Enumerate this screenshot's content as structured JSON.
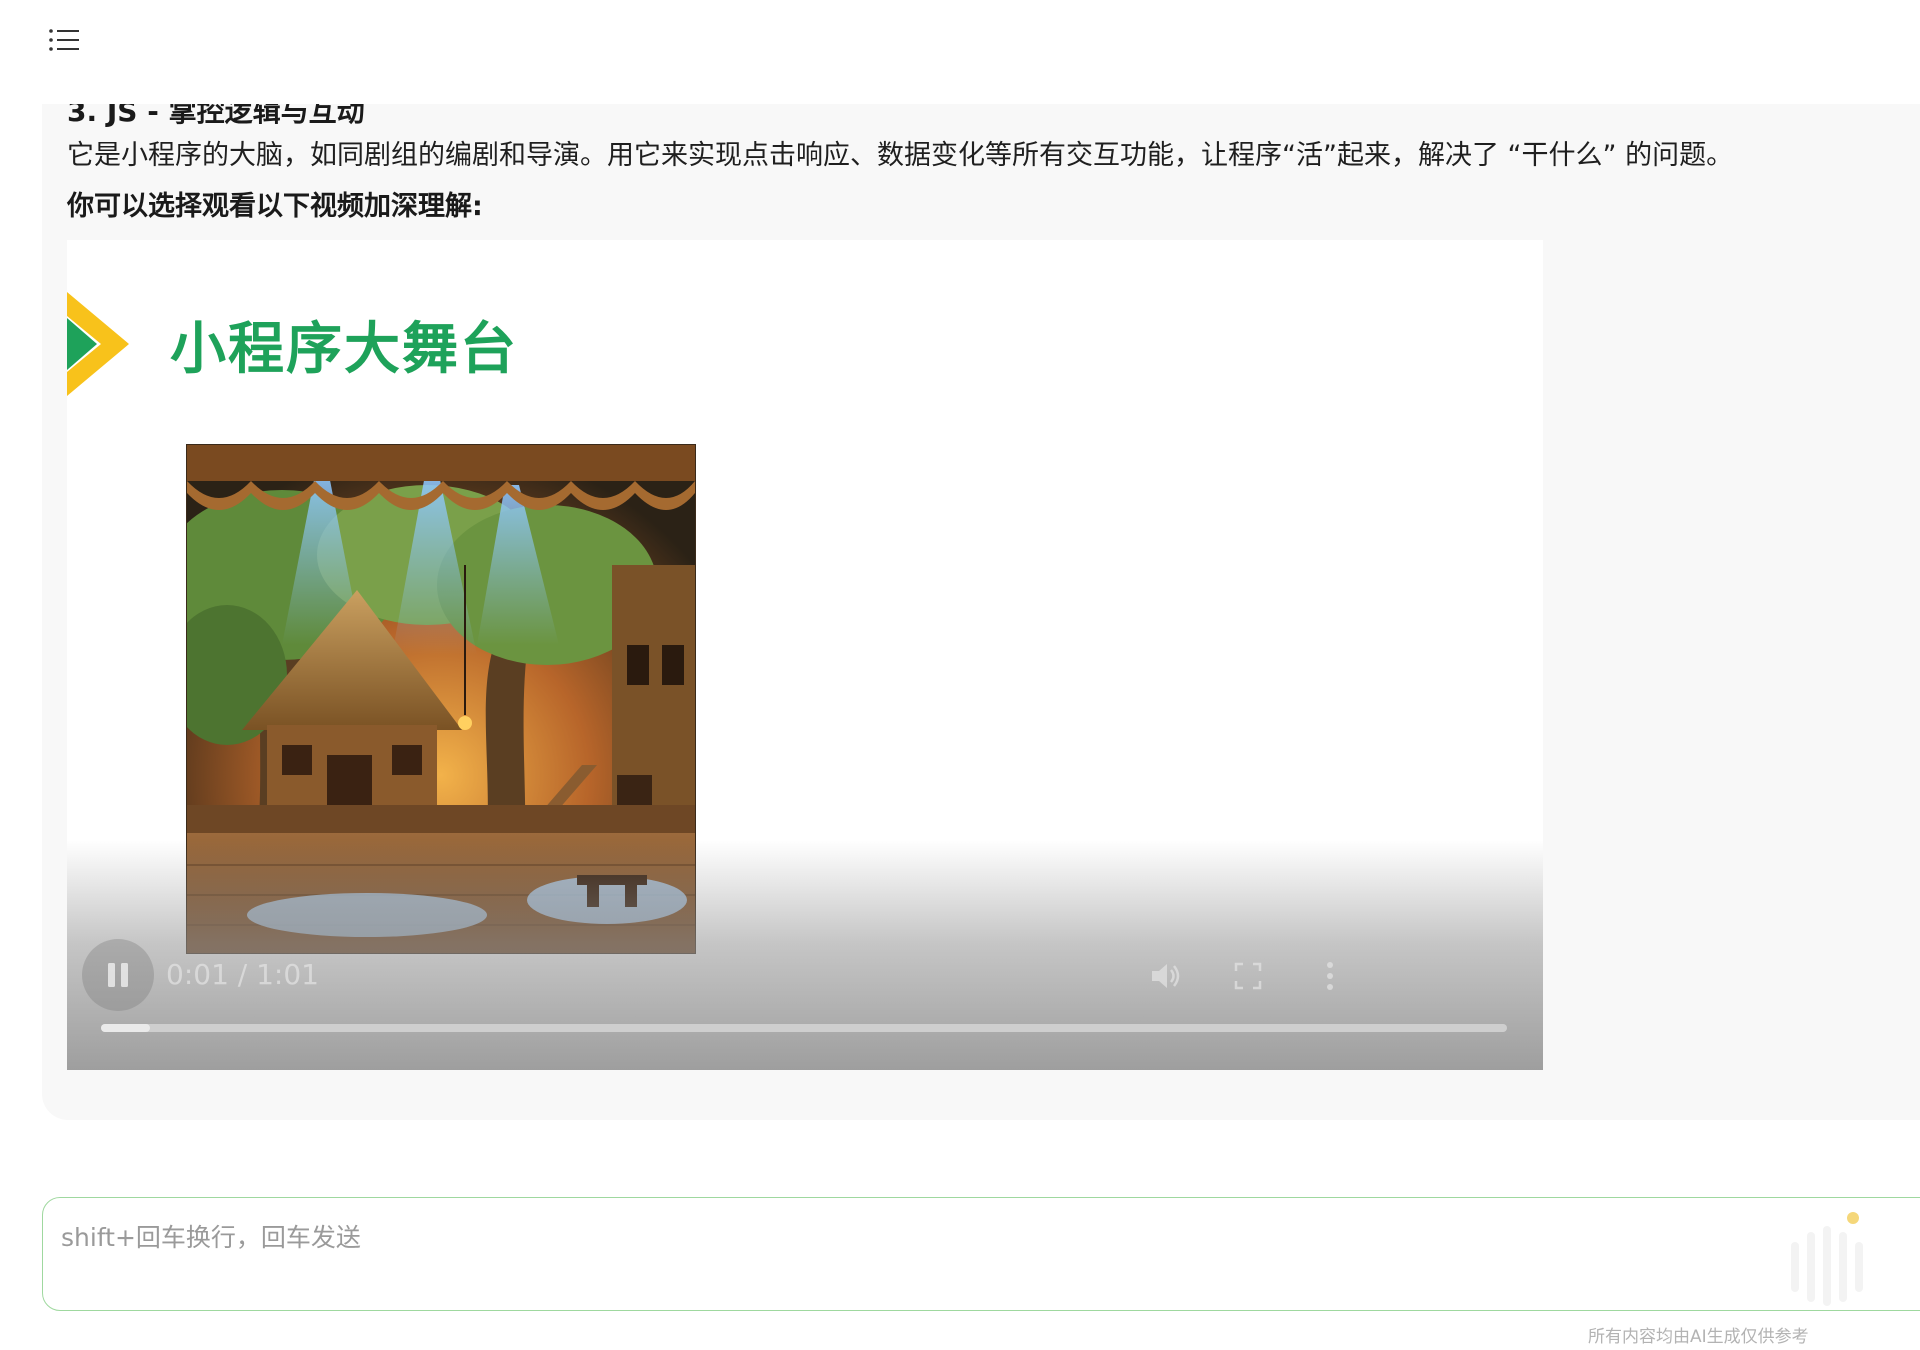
{
  "icons": {
    "menu": "list-icon",
    "slide_arrow": "play-arrow-icon",
    "play_pause": "pause-icon",
    "volume": "volume-icon",
    "fullscreen": "fullscreen-icon",
    "more": "more-vertical-icon",
    "voice": "voice-waveform-icon"
  },
  "message": {
    "section_heading": "3. JS - 掌控逻辑与互动",
    "paragraph": "它是小程序的大脑，如同剧组的编剧和导演。用它来实现点击响应、数据变化等所有交互功能，让程序“活”起来，解决了 “干什么” 的问题。",
    "video_prompt": "你可以选择观看以下视频加深理解:"
  },
  "video": {
    "slide_title": "小程序大舞台",
    "time_display": "0:01 / 1:01",
    "progress": 0.035,
    "image_alt": "木质舞台场景"
  },
  "composer": {
    "placeholder": "shift+回车换行，回车发送"
  },
  "footer": {
    "disclaimer": "所有内容均由AI生成仅供参考"
  },
  "colors": {
    "slide_title": "#1ea25a",
    "arrow_yellow": "#f8c21b",
    "arrow_green": "#1ea25a",
    "input_border": "#9fd89f",
    "voice_dot": "#f5d77a"
  }
}
